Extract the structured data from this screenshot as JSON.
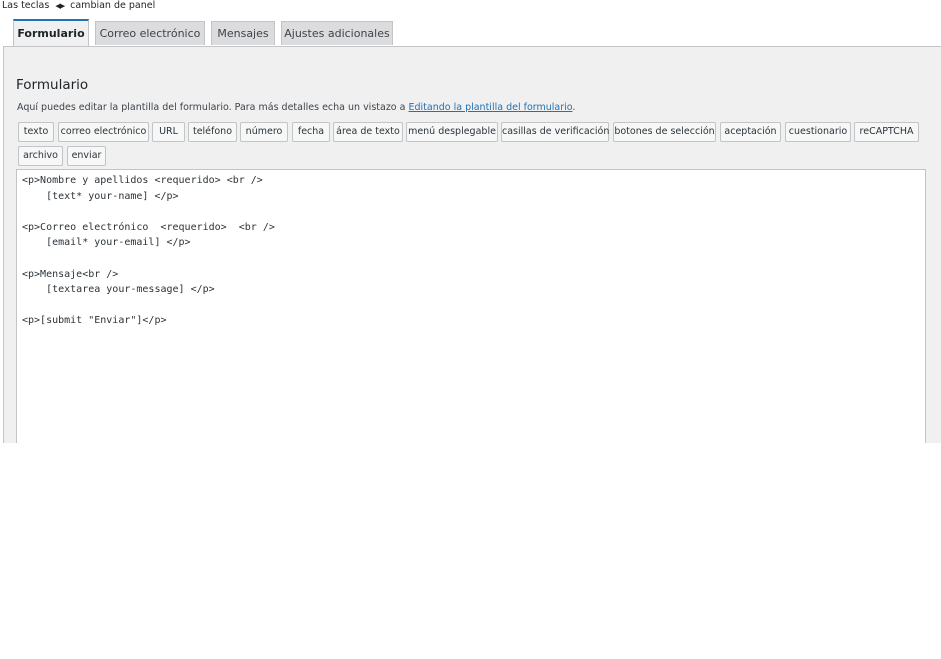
{
  "hint": {
    "prefix": "Las teclas",
    "arrows": "◀▶",
    "suffix": "cambian de panel"
  },
  "tabs": [
    {
      "label": "Formulario",
      "active": true
    },
    {
      "label": "Correo electrónico",
      "active": false
    },
    {
      "label": "Mensajes",
      "active": false
    },
    {
      "label": "Ajustes adicionales",
      "active": false
    }
  ],
  "panel": {
    "title": "Formulario",
    "description_prefix": "Aquí puedes editar la plantilla del formulario. Para más detalles echa un vistazo a ",
    "description_link": "Editando la plantilla del formulario",
    "description_suffix": ".",
    "tag_buttons": [
      "texto",
      "correo electrónico",
      "URL",
      "teléfono",
      "número",
      "fecha",
      "área de texto",
      "menú desplegable",
      "casillas de verificación",
      "botones de selección",
      "aceptación",
      "cuestionario",
      "reCAPTCHA",
      "archivo",
      "enviar"
    ],
    "template": "<p>Nombre y apellidos <requerido> <br />\n    [text* your-name] </p>\n\n<p>Correo electrónico  <requerido>  <br />\n    [email* your-email] </p>\n\n<p>Mensaje<br />\n    [textarea your-message] </p>\n\n<p>[submit \"Enviar\"]</p>"
  },
  "colors": {
    "accent": "#2271b1",
    "panel_bg": "#f0f0f1",
    "tab_bg": "#dcdcde",
    "border": "#c3c4c7"
  }
}
